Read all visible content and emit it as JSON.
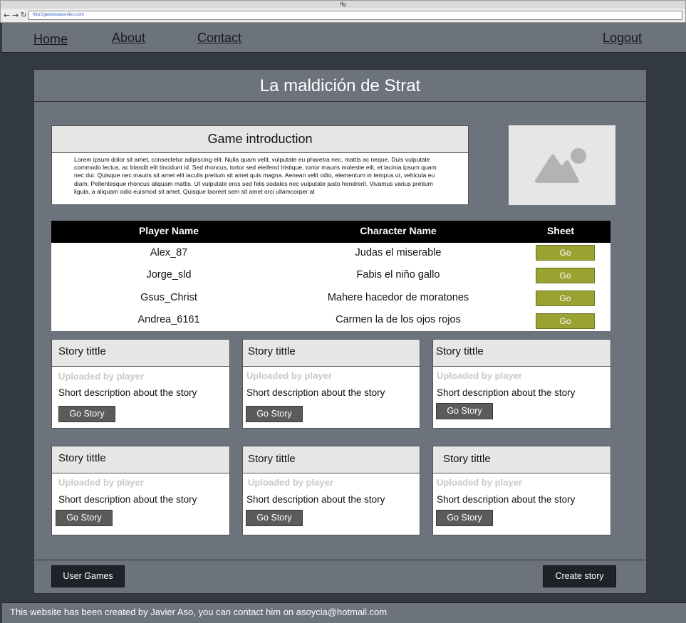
{
  "browser": {
    "title": "ffg",
    "url": "http://gestionatusroles.com",
    "back_icon": "arrow-left-icon",
    "forward_icon": "arrow-right-icon",
    "reload_icon": "reload-icon"
  },
  "nav": {
    "home": "Home",
    "about": "About",
    "contact": "Contact",
    "logout": "Logout"
  },
  "page": {
    "title": "La maldición de Strat"
  },
  "intro": {
    "title": "Game introduction",
    "text": "Lorem ipsum dolor sit amet, consectetur adipiscing elit. Nulla quam velit, vulputate eu pharetra nec, mattis ac neque. Duis vulputate commodo lectus, ac blandit elit tincidunt id. Sed rhoncus, tortor sed eleifend tristique, tortor mauris molestie elit, et lacinia ipsum quam nec dui. Quisque nec mauris sit amet elit iaculis pretium sit amet quis magna. Aenean velit odio, elementum in tempus ut, vehicula eu diam. Pellentesque rhoncus aliquam mattis. Ut vulputate eros sed felis sodales nec vulputate justo hendrerit. Vivamus varius pretium ligula, a aliquam odio euismod sit amet. Quisque laoreet sem sit amet orci ullamcorper at",
    "image_icon": "image-placeholder-icon"
  },
  "table": {
    "headers": [
      "Player Name",
      "Character Name",
      "Sheet"
    ],
    "rows": [
      {
        "player": "Alex_87",
        "character": "Judas el miserable",
        "button": "Go"
      },
      {
        "player": "Jorge_sld",
        "character": "Fabis el niño gallo",
        "button": "Go"
      },
      {
        "player": "Gsus_Christ",
        "character": "Mahere hacedor de moratones",
        "button": "Go"
      },
      {
        "player": "Andrea_6161",
        "character": "Carmen la de los ojos rojos",
        "button": "Go"
      }
    ]
  },
  "stories": [
    {
      "title": "Story tittle",
      "uploaded": "Uploaded by player",
      "description": "Short description about the story",
      "button": "Go Story"
    },
    {
      "title": "Story tittle",
      "uploaded": "Uploaded by player",
      "description": "Short description about the story",
      "button": "Go Story"
    },
    {
      "title": "Story tittle",
      "uploaded": "Uploaded by player",
      "description": "Short description about the story",
      "button": "Go Story"
    },
    {
      "title": "Story tittle",
      "uploaded": "Uploaded by player",
      "description": "Short description about the story",
      "button": "Go Story"
    },
    {
      "title": "Story tittle",
      "uploaded": "Uploaded by player",
      "description": "Short description about the story",
      "button": "Go Story"
    },
    {
      "title": "Story tittle",
      "uploaded": "Uploaded by player",
      "description": "Short description about the story",
      "button": "Go Story"
    }
  ],
  "actions": {
    "user_games": "User Games",
    "create_story": "Create story"
  },
  "footer": {
    "text": "This website has been created by Javier Aso, you can contact him on asoycia@hotmail.com"
  },
  "colors": {
    "panel": "#6c737c",
    "background": "#343a42",
    "go_button": "#9aa232",
    "story_button": "#5b5b5b",
    "table_header": "#000000"
  }
}
